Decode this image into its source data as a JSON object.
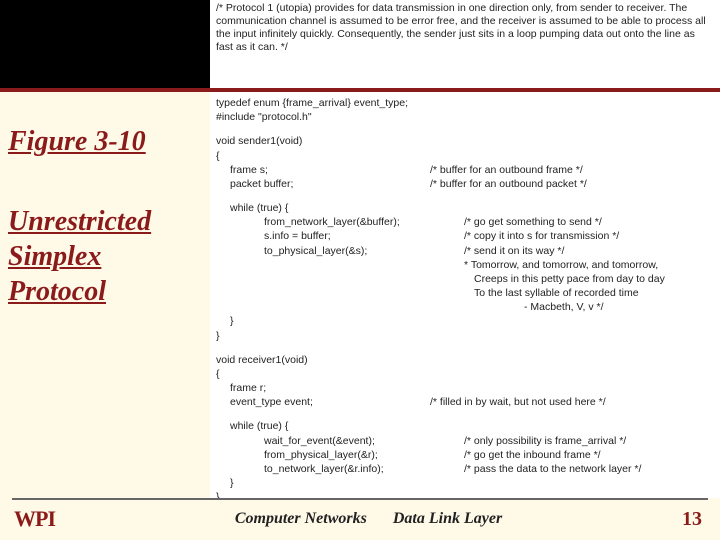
{
  "header_comment": "/* Protocol 1 (utopia) provides for data transmission in one direction only, from sender to receiver.  The communication channel is assumed to be error free, and the receiver is assumed to be able to process all the input infinitely quickly. Consequently, the sender just sits in a loop pumping data out onto the line as fast as it can. */",
  "figure_label": "Figure 3-10",
  "figure_title": "Unrestricted Simplex Protocol",
  "code": {
    "typedef": "typedef enum {frame_arrival} event_type;",
    "include": "#include \"protocol.h\"",
    "sender_sig": "void sender1(void)",
    "brace_open": "{",
    "frame_s": {
      "code": "frame s;",
      "comment": "/* buffer for an outbound frame */"
    },
    "packet_buffer": {
      "code": "packet buffer;",
      "comment": "/* buffer for an outbound packet */"
    },
    "while_true": "while (true) {",
    "from_nl": {
      "code": "from_network_layer(&buffer);",
      "comment": "/* go get something to send */"
    },
    "sinfo": {
      "code": "s.info = buffer;",
      "comment": "/* copy it into s for transmission */"
    },
    "to_phys": {
      "code": "to_physical_layer(&s);",
      "comment": "/* send it on its way */"
    },
    "macbeth1": "* Tomorrow, and tomorrow, and tomorrow,",
    "macbeth2": "Creeps in this petty pace from day to day",
    "macbeth3": "To the last syllable of recorded time",
    "macbeth4": "- Macbeth, V, v */",
    "brace_close_inner": "}",
    "brace_close": "}",
    "receiver_sig": "void receiver1(void)",
    "frame_r": "frame r;",
    "event_decl": {
      "code": "event_type event;",
      "comment": "/* filled in by wait, but not used here */"
    },
    "wait_event": {
      "code": "wait_for_event(&event);",
      "comment": "/* only possibility is frame_arrival */"
    },
    "from_phys": {
      "code": "from_physical_layer(&r);",
      "comment": "/* go get the inbound frame */"
    },
    "to_nl": {
      "code": "to_network_layer(&r.info);",
      "comment": "/* pass the data to the network layer */"
    }
  },
  "footer": {
    "logo": "WPI",
    "mid1": "Computer Networks",
    "mid2": "Data Link Layer",
    "page": "13"
  }
}
